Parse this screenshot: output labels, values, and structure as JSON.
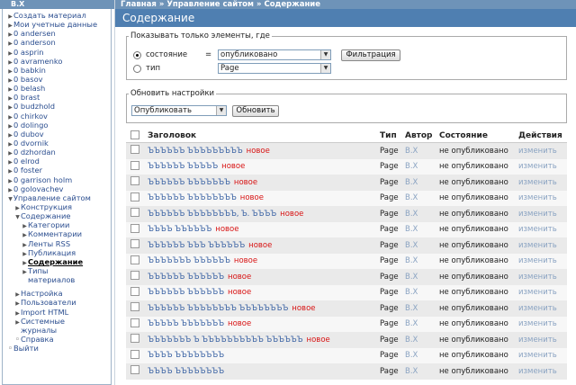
{
  "sidebar": {
    "header": "B.X",
    "items": [
      {
        "label": "Создать материал",
        "level": 1
      },
      {
        "label": "Мои учетные данные",
        "level": 1
      },
      {
        "label": "0 andersen",
        "level": 1
      },
      {
        "label": "0 anderson",
        "level": 1
      },
      {
        "label": "0 asprin",
        "level": 1
      },
      {
        "label": "0 avramenko",
        "level": 1
      },
      {
        "label": "0 babkin",
        "level": 1
      },
      {
        "label": "0 basov",
        "level": 1
      },
      {
        "label": "0 belash",
        "level": 1
      },
      {
        "label": "0 brast",
        "level": 1
      },
      {
        "label": "0 budzhold",
        "level": 1
      },
      {
        "label": "0 chirkov",
        "level": 1
      },
      {
        "label": "0 dolingo",
        "level": 1
      },
      {
        "label": "0 dubov",
        "level": 1
      },
      {
        "label": "0 dvornik",
        "level": 1
      },
      {
        "label": "0 dzhordan",
        "level": 1
      },
      {
        "label": "0 elrod",
        "level": 1
      },
      {
        "label": "0 foster",
        "level": 1
      },
      {
        "label": "0 garrison holm",
        "level": 1
      },
      {
        "label": "0 golovachev",
        "level": 1
      },
      {
        "label": "Управление сайтом",
        "level": 1,
        "expanded": true
      },
      {
        "label": "Конструкция",
        "level": 2
      },
      {
        "label": "Содержание",
        "level": 2,
        "expanded": true
      },
      {
        "label": "Категории",
        "level": 3
      },
      {
        "label": "Комментарии",
        "level": 3
      },
      {
        "label": "Ленты RSS",
        "level": 3
      },
      {
        "label": "Публикация",
        "level": 3
      },
      {
        "label": "Содержание",
        "level": 3,
        "active": true
      },
      {
        "label": "Типы материалов",
        "level": 3,
        "tall": true
      },
      {
        "gap": true
      },
      {
        "label": "Настройка",
        "level": 2
      },
      {
        "label": "Пользователи",
        "level": 2
      },
      {
        "label": "Import HTML",
        "level": 2
      },
      {
        "label": "Системные журналы",
        "level": 2,
        "tall": true
      },
      {
        "label": "Справка",
        "level": 2,
        "round": true
      },
      {
        "label": "Выйти",
        "level": 1,
        "round": true
      }
    ]
  },
  "breadcrumbs": [
    "Главная",
    "Управление сайтом",
    "Содержание"
  ],
  "breadcrumb_sep": "»",
  "page_title": "Содержание",
  "filter": {
    "legend": "Показывать только элементы, где",
    "status_label": "состояние",
    "type_label": "тип",
    "equals": "=",
    "status_value": "опубликовано",
    "type_value": "Page",
    "button": "Фильтрация"
  },
  "update": {
    "legend": "Обновить настройки",
    "action_value": "Опубликовать",
    "button": "Обновить"
  },
  "table": {
    "headers": {
      "title": "Заголовок",
      "type": "Тип",
      "author": "Автор",
      "status": "Состояние",
      "actions": "Действия"
    },
    "rows": [
      {
        "title": "ЪЪЪЪЪЪ ЪЪЪЪЪЪЪЪЪ",
        "new": "новое",
        "type": "Page",
        "author": "B.X",
        "status": "не опубликовано",
        "action": "изменить"
      },
      {
        "title": "ЪЪЪЪЪЪ ЪЪЪЪЪ",
        "new": "новое",
        "type": "Page",
        "author": "B.X",
        "status": "не опубликовано",
        "action": "изменить"
      },
      {
        "title": "ЪЪЪЪЪЪ ЪЪЪЪЪЪЪ",
        "new": "новое",
        "type": "Page",
        "author": "B.X",
        "status": "не опубликовано",
        "action": "изменить"
      },
      {
        "title": "ЪЪЪЪЪЪ ЪЪЪЪЪЪЪЪ",
        "new": "новое",
        "type": "Page",
        "author": "B.X",
        "status": "не опубликовано",
        "action": "изменить"
      },
      {
        "title": "ЪЪЪЪЪЪ ЪЪЪЪЪЪЪЪ, Ъ. ЪЪЪЪ",
        "new": "новое",
        "type": "Page",
        "author": "B.X",
        "status": "не опубликовано",
        "action": "изменить"
      },
      {
        "title": "ЪЪЪЪ ЪЪЪЪЪЪ",
        "new": "новое",
        "type": "Page",
        "author": "B.X",
        "status": "не опубликовано",
        "action": "изменить"
      },
      {
        "title": "ЪЪЪЪЪЪ ЪЪЪ ЪЪЪЪЪЪ",
        "new": "новое",
        "type": "Page",
        "author": "B.X",
        "status": "не опубликовано",
        "action": "изменить"
      },
      {
        "title": "ЪЪЪЪЪЪЪ ЪЪЪЪЪЪ",
        "new": "новое",
        "type": "Page",
        "author": "B.X",
        "status": "не опубликовано",
        "action": "изменить"
      },
      {
        "title": "ЪЪЪЪЪЪ ЪЪЪЪЪЪ",
        "new": "новое",
        "type": "Page",
        "author": "B.X",
        "status": "не опубликовано",
        "action": "изменить"
      },
      {
        "title": "ЪЪЪЪЪЪ ЪЪЪЪЪЪ",
        "new": "новое",
        "type": "Page",
        "author": "B.X",
        "status": "не опубликовано",
        "action": "изменить"
      },
      {
        "title": "ЪЪЪЪЪЪ ЪЪЪЪЪЪЪЪ ЪЪЪЪЪЪЪЪ",
        "new": "новое",
        "type": "Page",
        "author": "B.X",
        "status": "не опубликовано",
        "action": "изменить"
      },
      {
        "title": "ЪЪЪЪЪ ЪЪЪЪЪЪЪ",
        "new": "новое",
        "type": "Page",
        "author": "B.X",
        "status": "не опубликовано",
        "action": "изменить"
      },
      {
        "title": "ЪЪЪЪЪЪЪ Ъ ЪЪЪЪЪЪЪЪЪЪ ЪЪЪЪЪЪ",
        "new": "новое",
        "type": "Page",
        "author": "B.X",
        "status": "не опубликовано",
        "action": "изменить"
      },
      {
        "title": "ЪЪЪЪ ЪЪЪЪЪЪЪЪ",
        "new": "",
        "type": "Page",
        "author": "B.X",
        "status": "не опубликовано",
        "action": "изменить"
      },
      {
        "title": "ЪЪЪЪ ЪЪЪЪЪЪЪЪ",
        "new": "",
        "type": "Page",
        "author": "B.X",
        "status": "не опубликовано",
        "action": "изменить"
      }
    ]
  },
  "colors": {
    "accent": "#4f7fb1",
    "header": "#6e93b8",
    "link": "#3b63a4",
    "new": "#d81414"
  }
}
